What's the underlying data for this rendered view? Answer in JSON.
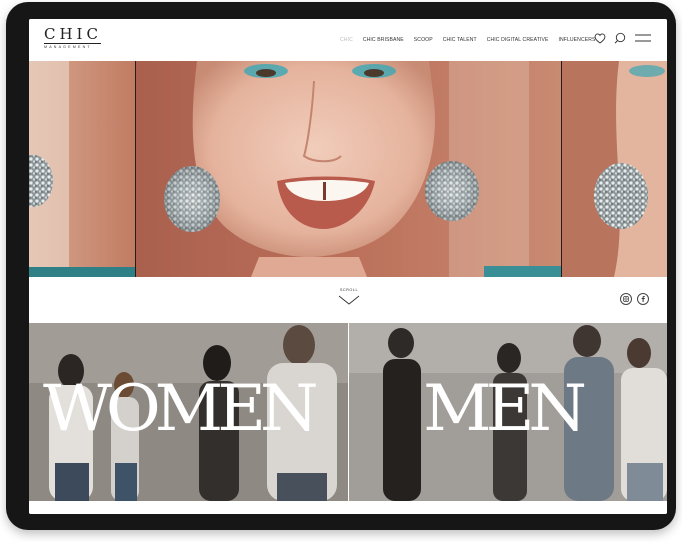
{
  "brand": {
    "logo_main": "CHIC",
    "logo_sub": "MANAGEMENT"
  },
  "nav": {
    "items": [
      {
        "label": "CHIC",
        "active": true
      },
      {
        "label": "CHIC BRISBANE",
        "active": false
      },
      {
        "label": "SCOOP",
        "active": false
      },
      {
        "label": "CHIC TALENT",
        "active": false
      },
      {
        "label": "CHIC DIGITAL CREATIVE",
        "active": false
      },
      {
        "label": "INFLUENCERS",
        "active": false
      }
    ],
    "icons": [
      "heart-icon",
      "search-icon",
      "menu-icon"
    ]
  },
  "scroll": {
    "label": "SCROLL",
    "icon": "chevron-down-icon"
  },
  "social": [
    "instagram-icon",
    "facebook-icon"
  ],
  "categories": {
    "women": "WOMEN",
    "men": "MEN"
  },
  "colors": {
    "device_frame": "#161616",
    "hero_backdrop": "#b06a55",
    "eyeshadow": "#3aa7b5"
  }
}
